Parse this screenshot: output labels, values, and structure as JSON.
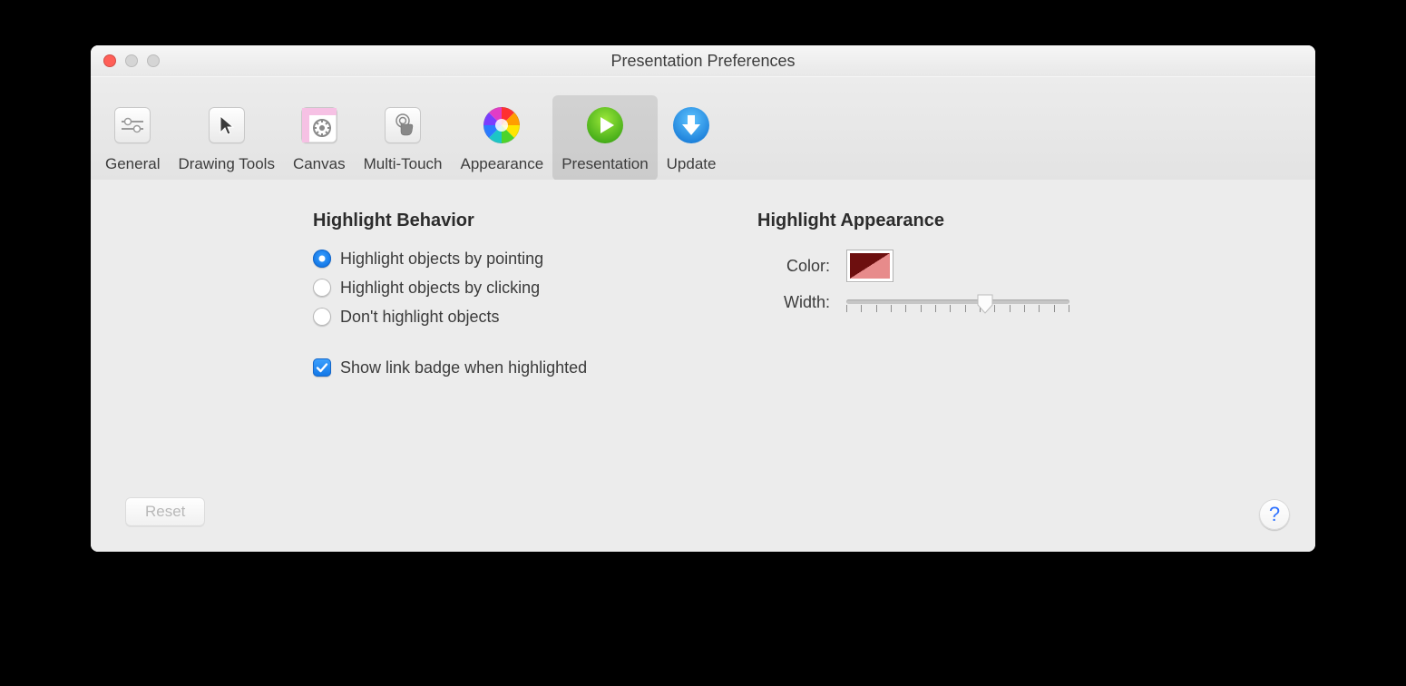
{
  "window": {
    "title": "Presentation Preferences"
  },
  "toolbar": {
    "items": [
      {
        "id": "general",
        "label": "General"
      },
      {
        "id": "drawing-tools",
        "label": "Drawing Tools"
      },
      {
        "id": "canvas",
        "label": "Canvas"
      },
      {
        "id": "multi-touch",
        "label": "Multi-Touch"
      },
      {
        "id": "appearance",
        "label": "Appearance"
      },
      {
        "id": "presentation",
        "label": "Presentation"
      },
      {
        "id": "update",
        "label": "Update"
      }
    ],
    "selected": "presentation"
  },
  "behavior": {
    "title": "Highlight Behavior",
    "options": [
      "Highlight objects by pointing",
      "Highlight objects by clicking",
      "Don't highlight objects"
    ],
    "selected_index": 0,
    "checkbox": {
      "label": "Show link badge when highlighted",
      "checked": true
    }
  },
  "appearance": {
    "title": "Highlight Appearance",
    "color_label": "Color:",
    "color_dark": "#6d0f0f",
    "color_light": "#e78b8b",
    "width_label": "Width:",
    "width_value": 0.62,
    "tick_count": 16
  },
  "footer": {
    "reset_label": "Reset",
    "help_label": "?"
  }
}
